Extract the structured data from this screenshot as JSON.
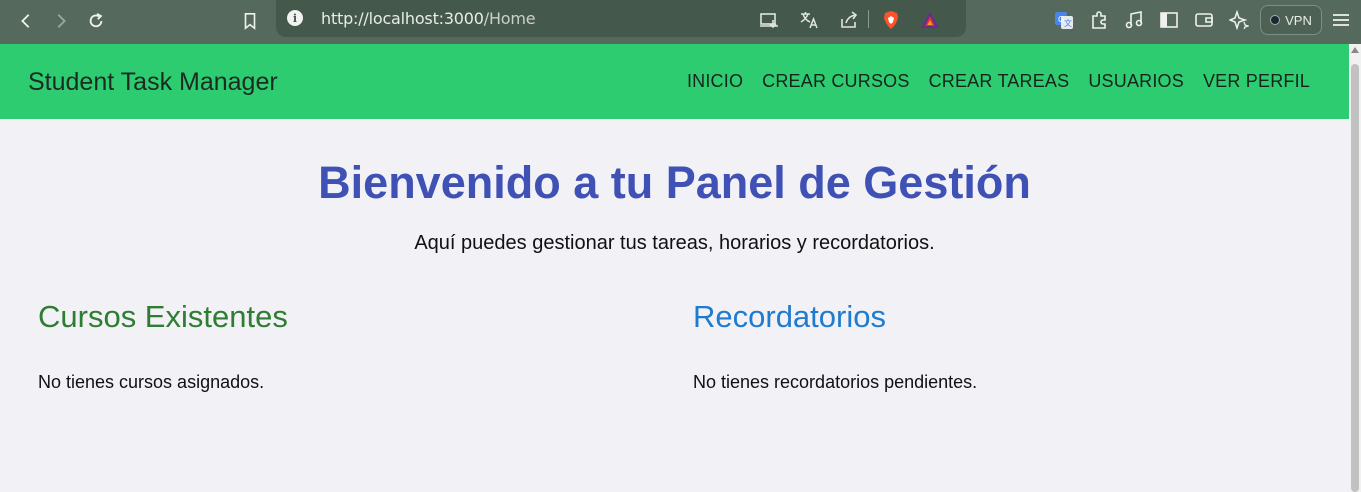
{
  "browser": {
    "url_host": "http://localhost:3000",
    "url_path": "/Home",
    "vpn_label": "VPN",
    "icons": [
      "back-icon",
      "forward-icon",
      "reload-icon",
      "bookmark-icon",
      "info-icon",
      "install-icon",
      "translate-icon",
      "share-icon",
      "brave-shields-icon",
      "brave-rewards-icon",
      "google-translate-icon",
      "extensions-icon",
      "media-icon",
      "sidebar-icon",
      "wallet-icon",
      "leo-ai-icon",
      "menu-icon"
    ],
    "accent": "#556a5c"
  },
  "navbar": {
    "brand": "Student Task Manager",
    "links": [
      "INICIO",
      "CREAR CURSOS",
      "CREAR TAREAS",
      "USUARIOS",
      "VER PERFIL"
    ],
    "background": "#2ecc71"
  },
  "main": {
    "title": "Bienvenido a tu Panel de Gestión",
    "subtitle": "Aquí puedes gestionar tus tareas, horarios y recordatorios.",
    "courses": {
      "heading": "Cursos Existentes",
      "empty_text": "No tienes cursos asignados."
    },
    "reminders": {
      "heading": "Recordatorios",
      "empty_text": "No tienes recordatorios pendientes."
    },
    "colors": {
      "title": "#3f51b5",
      "courses_heading": "#2e7d32",
      "reminders_heading": "#1e7bd0"
    }
  }
}
